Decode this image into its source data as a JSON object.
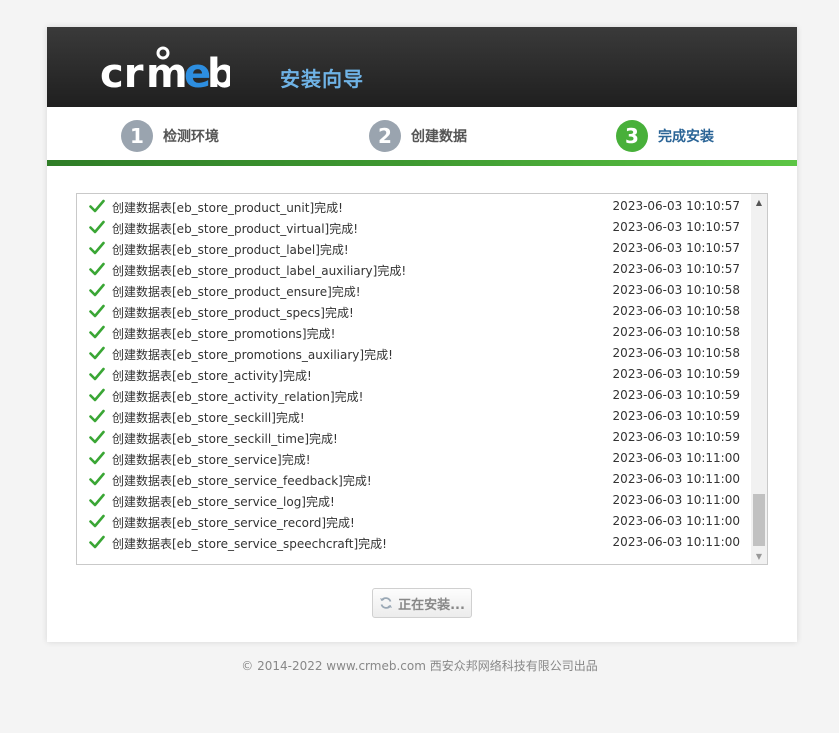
{
  "header": {
    "logo_text": "crmeb",
    "title": "安装向导"
  },
  "steps": [
    {
      "number": "1",
      "label": "检测环境"
    },
    {
      "number": "2",
      "label": "创建数据"
    },
    {
      "number": "3",
      "label": "完成安装"
    }
  ],
  "log": [
    {
      "text": "创建数据表[eb_store_product_unit]完成!",
      "time": "2023-06-03 10:10:57"
    },
    {
      "text": "创建数据表[eb_store_product_virtual]完成!",
      "time": "2023-06-03 10:10:57"
    },
    {
      "text": "创建数据表[eb_store_product_label]完成!",
      "time": "2023-06-03 10:10:57"
    },
    {
      "text": "创建数据表[eb_store_product_label_auxiliary]完成!",
      "time": "2023-06-03 10:10:57"
    },
    {
      "text": "创建数据表[eb_store_product_ensure]完成!",
      "time": "2023-06-03 10:10:58"
    },
    {
      "text": "创建数据表[eb_store_product_specs]完成!",
      "time": "2023-06-03 10:10:58"
    },
    {
      "text": "创建数据表[eb_store_promotions]完成!",
      "time": "2023-06-03 10:10:58"
    },
    {
      "text": "创建数据表[eb_store_promotions_auxiliary]完成!",
      "time": "2023-06-03 10:10:58"
    },
    {
      "text": "创建数据表[eb_store_activity]完成!",
      "time": "2023-06-03 10:10:59"
    },
    {
      "text": "创建数据表[eb_store_activity_relation]完成!",
      "time": "2023-06-03 10:10:59"
    },
    {
      "text": "创建数据表[eb_store_seckill]完成!",
      "time": "2023-06-03 10:10:59"
    },
    {
      "text": "创建数据表[eb_store_seckill_time]完成!",
      "time": "2023-06-03 10:10:59"
    },
    {
      "text": "创建数据表[eb_store_service]完成!",
      "time": "2023-06-03 10:11:00"
    },
    {
      "text": "创建数据表[eb_store_service_feedback]完成!",
      "time": "2023-06-03 10:11:00"
    },
    {
      "text": "创建数据表[eb_store_service_log]完成!",
      "time": "2023-06-03 10:11:00"
    },
    {
      "text": "创建数据表[eb_store_service_record]完成!",
      "time": "2023-06-03 10:11:00"
    },
    {
      "text": "创建数据表[eb_store_service_speechcraft]完成!",
      "time": "2023-06-03 10:11:00"
    }
  ],
  "button": {
    "label": "正在安装..."
  },
  "footer": {
    "text": "© 2014-2022 www.crmeb.com 西安众邦网络科技有限公司出品"
  },
  "colors": {
    "header_bg": "#2b2b2b",
    "title": "#6fb3e6",
    "step_active": "#48b03a",
    "step_inactive": "#9aa4af",
    "check": "#3aa635"
  },
  "icons": {
    "check": "check-icon",
    "refresh": "refresh-icon"
  }
}
